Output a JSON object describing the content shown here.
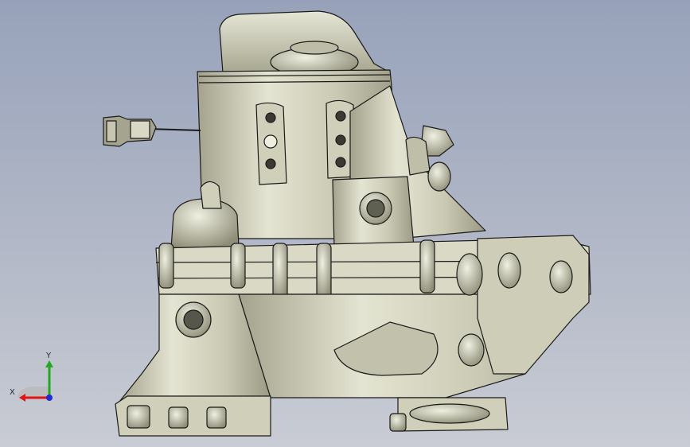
{
  "viewport": {
    "background_top": "#97a2ba",
    "background_bottom": "#c9ccd4",
    "model_fill": "#d3d3bf",
    "model_shade": "#a8a891",
    "edge_color": "#1a1a1a"
  },
  "triad": {
    "x_label": "X",
    "y_label": "Y",
    "x_color": "#e01515",
    "y_color": "#1faa1f",
    "z_color": "#1f2bd6"
  }
}
